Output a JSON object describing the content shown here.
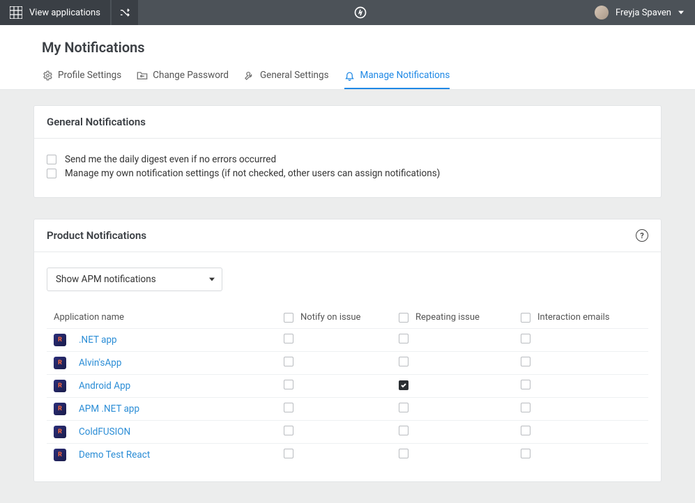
{
  "topbar": {
    "view_apps_label": "View applications",
    "user_name": "Freyja Spaven"
  },
  "page": {
    "title": "My Notifications"
  },
  "tabs": [
    {
      "id": "profile",
      "label": "Profile Settings",
      "icon": "gear-icon"
    },
    {
      "id": "password",
      "label": "Change Password",
      "icon": "folder-key-icon"
    },
    {
      "id": "general",
      "label": "General Settings",
      "icon": "wrench-icon"
    },
    {
      "id": "notifications",
      "label": "Manage Notifications",
      "icon": "bell-icon",
      "active": true
    }
  ],
  "general_panel": {
    "title": "General Notifications",
    "opts": [
      {
        "label": "Send me the daily digest even if no errors occurred",
        "checked": false
      },
      {
        "label": "Manage my own notification settings (if not checked, other users can assign notifications)",
        "checked": false
      }
    ]
  },
  "product_panel": {
    "title": "Product Notifications",
    "dropdown": {
      "label": "Show APM notifications"
    },
    "columns": {
      "app": "Application name",
      "notify": "Notify on issue",
      "repeating": "Repeating issue",
      "interaction": "Interaction emails"
    },
    "rows": [
      {
        "name": ".NET app",
        "notify": false,
        "repeating": false,
        "interaction": false
      },
      {
        "name": "Alvin'sApp",
        "notify": false,
        "repeating": false,
        "interaction": false
      },
      {
        "name": "Android App",
        "notify": false,
        "repeating": true,
        "interaction": false
      },
      {
        "name": "APM .NET app",
        "notify": false,
        "repeating": false,
        "interaction": false
      },
      {
        "name": "ColdFUSION",
        "notify": false,
        "repeating": false,
        "interaction": false
      },
      {
        "name": "Demo Test React",
        "notify": false,
        "repeating": false,
        "interaction": false
      }
    ]
  }
}
